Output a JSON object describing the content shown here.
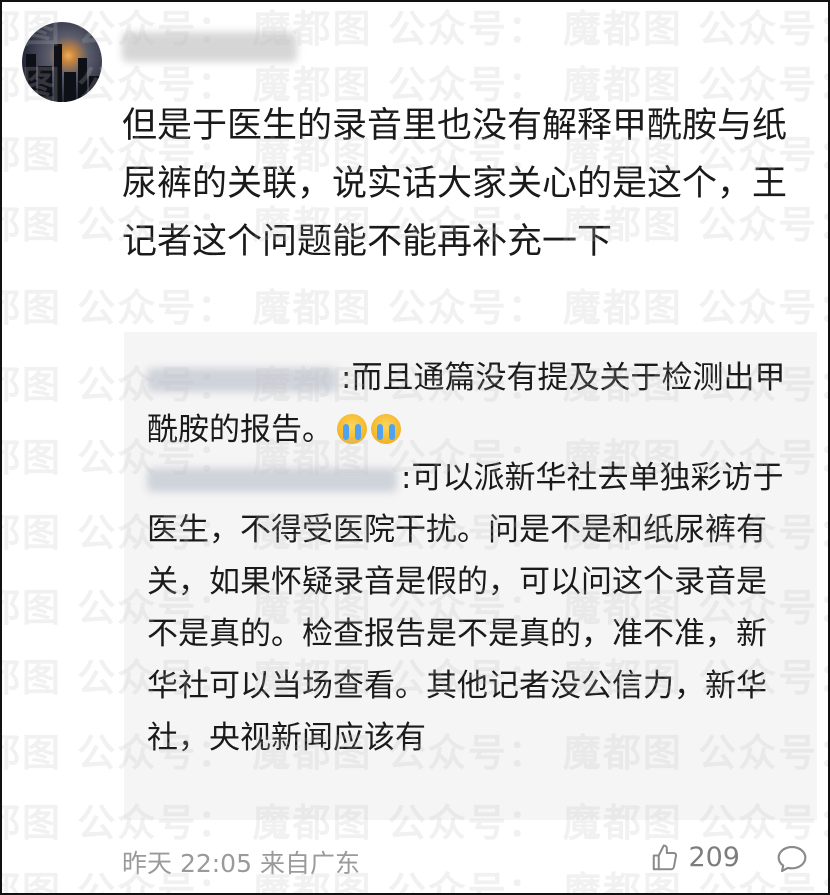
{
  "comment": {
    "text": "但是于医生的录音里也没有解释甲酰胺与纸尿裤的关联，说实话大家关心的是这个，王记者这个问题能不能再补充一下"
  },
  "replies": [
    {
      "text": ":而且通篇没有提及关于检测出甲酰胺的报告。",
      "emoji": "crying-face"
    },
    {
      "text": ":可以派新华社去单独彩访于医生，不得受医院干扰。问是不是和纸尿裤有关，如果怀疑录音是假的，可以问这个录音是不是真的。检查报告是不是真的，准不准，新华社可以当场查看。其他记者没公信力，新华社，央视新闻应该有"
    }
  ],
  "footer": {
    "time_location": "昨天 22:05 来自广东",
    "like_count": "209"
  },
  "watermark": {
    "text": "魔都图   公众号："
  },
  "icons": {
    "like": "thumbs-up-icon",
    "comment": "comment-bubble-icon"
  }
}
